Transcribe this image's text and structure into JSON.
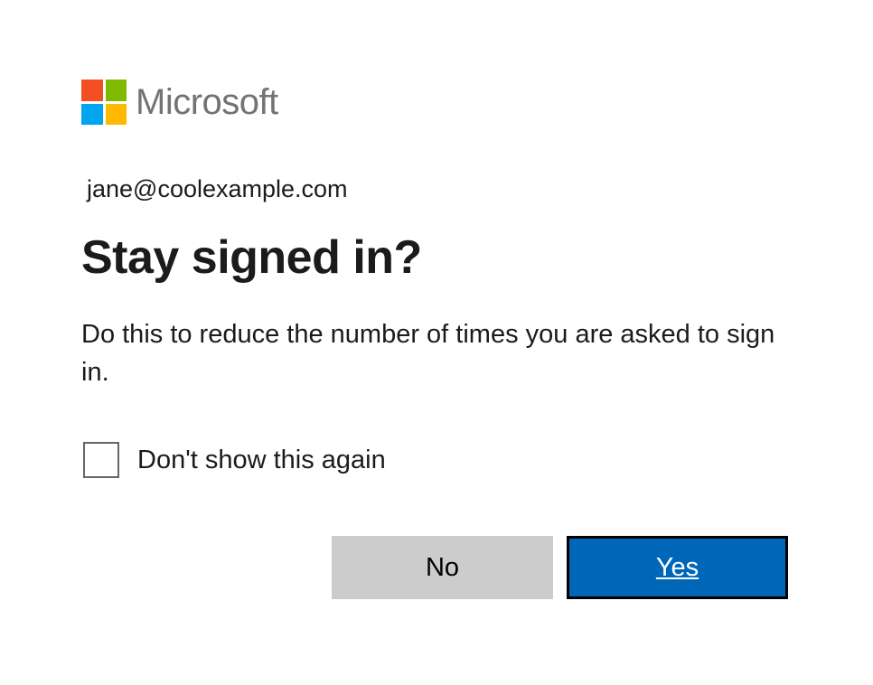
{
  "brand": {
    "name": "Microsoft",
    "colors": {
      "red": "#f25022",
      "green": "#7fba00",
      "blue": "#00a4ef",
      "yellow": "#ffb900"
    }
  },
  "account": {
    "email": "jane@coolexample.com"
  },
  "prompt": {
    "heading": "Stay signed in?",
    "description": "Do this to reduce the number of times you are asked to sign in."
  },
  "checkbox": {
    "label": "Don't show this again",
    "checked": false
  },
  "buttons": {
    "no": "No",
    "yes": "Yes"
  }
}
